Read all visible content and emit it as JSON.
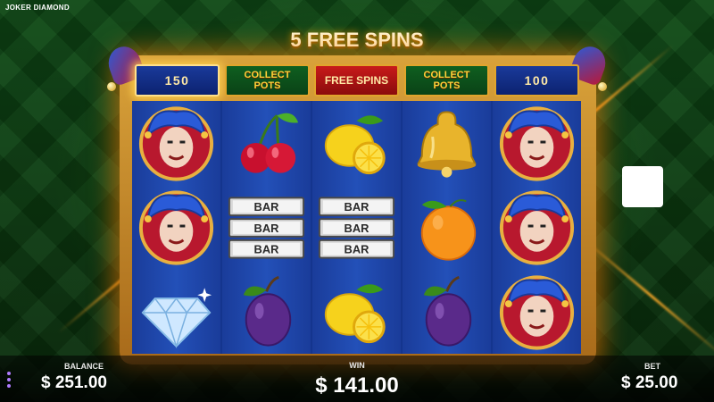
{
  "game": {
    "title": "JOKER DIAMOND"
  },
  "feature": {
    "free_spins_label": "5 FREE SPINS"
  },
  "header_boxes": [
    {
      "label": "150",
      "kind": "number",
      "active": true
    },
    {
      "label": "COLLECT POTS",
      "kind": "text"
    },
    {
      "label": "FREE SPINS",
      "kind": "free"
    },
    {
      "label": "COLLECT POTS",
      "kind": "text"
    },
    {
      "label": "100",
      "kind": "number"
    }
  ],
  "reels": [
    [
      "joker-icon",
      "joker-icon",
      "diamond-icon"
    ],
    [
      "cherry-icon",
      "bar-icon",
      "plum-icon"
    ],
    [
      "lemon-icon",
      "bar-icon",
      "lemon-icon"
    ],
    [
      "bell-icon",
      "orange-icon",
      "plum-icon"
    ],
    [
      "joker-icon",
      "joker-icon",
      "joker-icon"
    ]
  ],
  "bar_text": "BAR",
  "stats": {
    "balance_label": "BALANCE",
    "balance_value": "$ 251.00",
    "win_label": "WIN",
    "win_value": "$ 141.00",
    "bet_label": "BET",
    "bet_value": "$ 25.00"
  },
  "colors": {
    "frame_gold": "#d9a23a",
    "reel_blue": "#1a3c9a",
    "header_green": "#0f5f20",
    "header_red": "#c81a1a",
    "accent_yellow": "#ffd23a"
  }
}
